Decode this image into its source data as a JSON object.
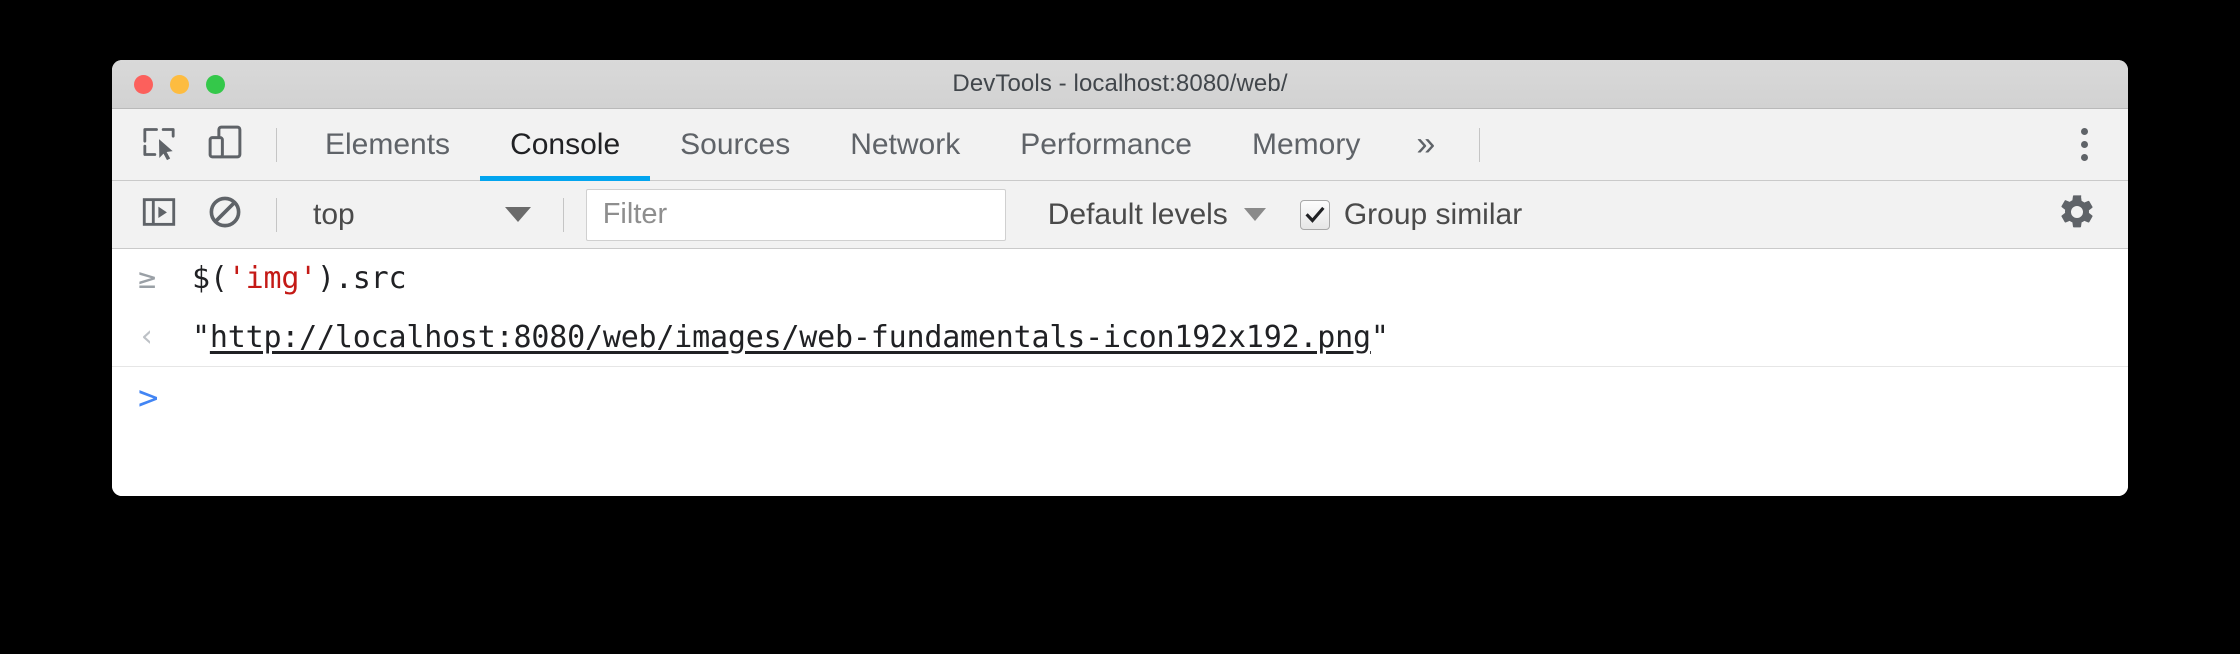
{
  "window": {
    "title": "DevTools - localhost:8080/web/",
    "traffic_lights": [
      {
        "name": "close",
        "color": "#fc605c"
      },
      {
        "name": "minimize",
        "color": "#fdbc40"
      },
      {
        "name": "zoom",
        "color": "#34c84a"
      }
    ]
  },
  "tabbar": {
    "inspect_tooltip": "Inspect element",
    "device_tooltip": "Toggle device toolbar",
    "tabs": [
      {
        "label": "Elements",
        "active": false
      },
      {
        "label": "Console",
        "active": true
      },
      {
        "label": "Sources",
        "active": false
      },
      {
        "label": "Network",
        "active": false
      },
      {
        "label": "Performance",
        "active": false
      },
      {
        "label": "Memory",
        "active": false
      }
    ],
    "overflow_label": "»",
    "active_tab_color": "#03a5ef",
    "menu_label": "Customize and control DevTools"
  },
  "console_toolbar": {
    "sidebar_toggle_name": "console-sidebar-icon",
    "clear_console_name": "clear-console-icon",
    "context_value": "top",
    "filter_placeholder": "Filter",
    "filter_value": "",
    "levels_label": "Default levels",
    "group_similar_label": "Group similar",
    "group_similar_checked": true,
    "settings_name": "gear-icon"
  },
  "console": {
    "rows": [
      {
        "type": "input",
        "caret": "≥",
        "segments": [
          {
            "text": "$(",
            "token": "plain"
          },
          {
            "text": "'img'",
            "token": "string"
          },
          {
            "text": ").src",
            "token": "plain"
          }
        ],
        "plain_text": "$('img').src"
      },
      {
        "type": "result",
        "caret": "‹",
        "quote_open": "\"",
        "link_text": "http://localhost:8080/web/images/web-fundamentals-icon192x192.png",
        "quote_close": "\""
      }
    ],
    "prompt_caret": ">",
    "prompt_value": "",
    "prompt_caret_color": "#4285f4",
    "string_token_color": "#c41a16"
  }
}
